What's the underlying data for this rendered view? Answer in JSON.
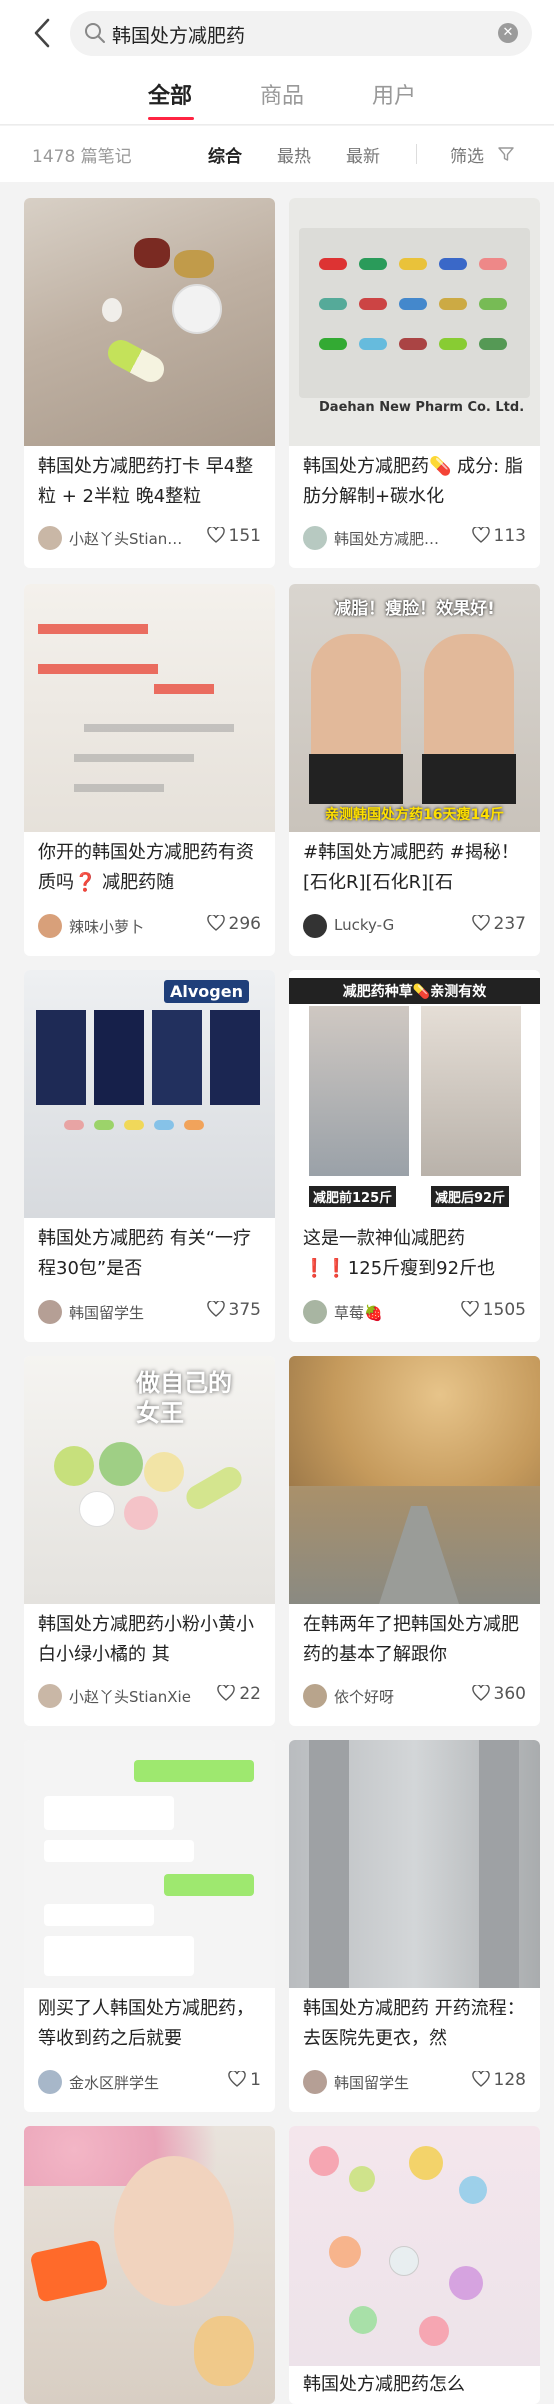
{
  "search": {
    "query": "韩国处方减肥药"
  },
  "tabs": [
    {
      "label": "全部",
      "active": true
    },
    {
      "label": "商品",
      "active": false
    },
    {
      "label": "用户",
      "active": false
    }
  ],
  "filters": {
    "count": "1478 篇笔记",
    "sorts": [
      "综合",
      "最热",
      "最新"
    ],
    "filter_label": "筛选"
  },
  "colors": {
    "accent": "#ff2442"
  },
  "cards": [
    {
      "title": "韩国处方减肥药打卡 早4整粒 + 2半粒 晚4整粒",
      "author": "小赵丫头Stian…",
      "likes": "151"
    },
    {
      "title": "韩国处方减肥药💊 成分: 脂肪分解制+碳水化",
      "author": "韩国处方减肥…",
      "likes": "113",
      "image_text": "Daehan New Pharm Co. Ltd."
    },
    {
      "title": "你开的韩国处方减肥药有资质吗❓ 减肥药随",
      "author": "辣味小萝卜",
      "likes": "296"
    },
    {
      "title": "#韩国处方减肥药 #揭秘！[石化R][石化R][石",
      "author": "Lucky-G",
      "likes": "237",
      "image_text": [
        "减脂！瘦脸！效果好!",
        "亲测韩国处方药16天瘦14斤"
      ]
    },
    {
      "title": "韩国处方减肥药 有关“一疗程30包”是否",
      "author": "韩国留学生",
      "likes": "375",
      "image_text": "Alvogen"
    },
    {
      "title": "这是一款神仙减肥药❗❗125斤瘦到92斤也",
      "author": "草莓🍓",
      "likes": "1505",
      "image_text": [
        "减肥药种草💊亲测有效",
        "减肥前125斤",
        "减肥后92斤"
      ]
    },
    {
      "title": "韩国处方减肥药小粉小黄小白小绿小橘的 其",
      "author": "小赵丫头StianXie",
      "likes": "22",
      "image_text": "做自己的女王"
    },
    {
      "title": "在韩两年了把韩国处方减肥药的基本了解跟你",
      "author": "依个好呀",
      "likes": "360"
    },
    {
      "title": "刚买了人韩国处方减肥药，等收到药之后就要",
      "author": "金水区胖学生",
      "likes": "1"
    },
    {
      "title": "韩国处方减肥药 开药流程：去医院先更衣，然",
      "author": "韩国留学生",
      "likes": "128"
    },
    {
      "title": "",
      "author": "",
      "likes": ""
    },
    {
      "title": "韩国处方减肥药怎么",
      "author": "",
      "likes": ""
    }
  ]
}
